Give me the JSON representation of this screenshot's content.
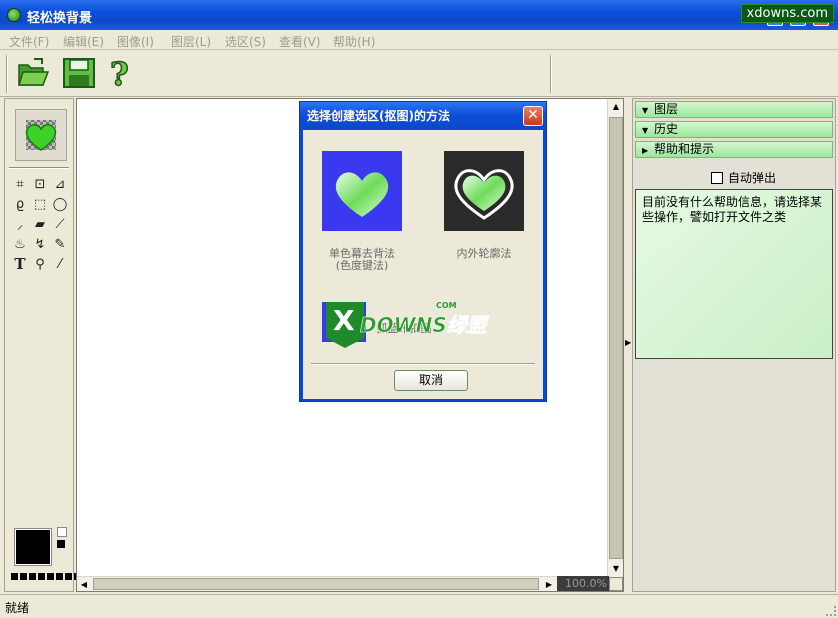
{
  "window": {
    "title": "轻松换背景",
    "watermark": "xdowns.com"
  },
  "menu": [
    "文件(F)",
    "编辑(E)",
    "图像(I)",
    "图层(L)",
    "选区(S)",
    "查看(V)",
    "帮助(H)"
  ],
  "toolbar": {
    "icons": [
      "open-folder-icon",
      "save-disk-icon",
      "help-question-icon"
    ]
  },
  "toolbox": {
    "active_tool_icon": "heart-selection-icon",
    "tools": [
      "crop-icon",
      "transform-icon",
      "perspective-icon",
      "lasso-icon",
      "rect-select-icon",
      "ellipse-select-icon",
      "magic-wand-icon",
      "eraser-icon",
      "brush-icon",
      "stamp-icon",
      "smudge-icon",
      "pin-icon",
      "text-icon",
      "zoom-icon",
      "eyedropper-icon"
    ],
    "text_tool_glyph": "T",
    "foreground_color": "#000000",
    "background_color": "#ffffff"
  },
  "canvas": {
    "zoom": "100.0%"
  },
  "right_panel": {
    "sections": [
      {
        "label": "图层",
        "expanded": true
      },
      {
        "label": "历史",
        "expanded": true
      },
      {
        "label": "帮助和提示",
        "expanded": false
      }
    ],
    "auto_popup_label": "自动弹出",
    "help_text": "目前没有什么帮助信息，请选择某些操作，譬如打开文件之类"
  },
  "status": {
    "text": "就绪"
  },
  "dialog": {
    "title": "选择创建选区(抠图)的方法",
    "close_glyph": "✕",
    "options": [
      {
        "label_line1": "单色幕去背法",
        "label_line2": "(色度键法)",
        "icon": "heart-blue-bg-icon"
      },
      {
        "label_line1": "内外轮廓法",
        "label_line2": "",
        "icon": "heart-outline-dark-icon"
      },
      {
        "label_line1": "抓蓝布扣图",
        "label_line2": "",
        "icon": "heart-small-icon"
      }
    ],
    "cancel_label": "取消",
    "logo_text": "DOWNS绿盟",
    "logo_com": "COM"
  },
  "colors": {
    "accent_green": "#9be79a",
    "title_blue": "#0c47d6",
    "dialog_close": "#c73b1b"
  }
}
